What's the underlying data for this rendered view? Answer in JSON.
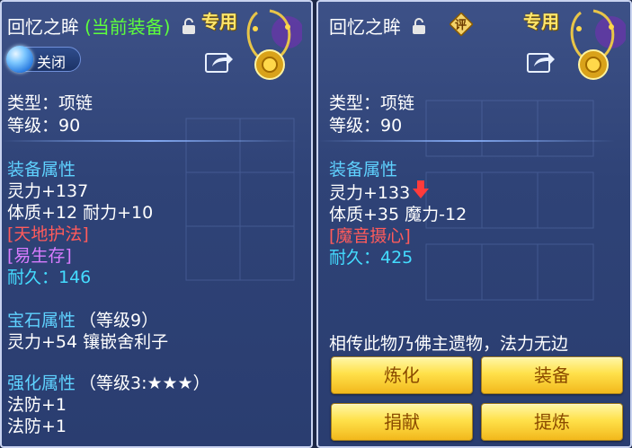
{
  "left": {
    "title": "回忆之眸",
    "equipped_tag": "(当前装备)",
    "exclusive": "专用",
    "toggle_label": "关闭",
    "type_line": "类型：项链",
    "level_line": "等级：90",
    "equip_attr_header": "装备属性",
    "attr_line1": "灵力+137",
    "attr_line2": "体质+12 耐力+10",
    "skill1": "[天地护法]",
    "skill2": "[易生存]",
    "durability": "耐久：146",
    "gem_header": "宝石属性",
    "gem_level": "（等级9）",
    "gem_line": "灵力+54 镶嵌舍利子",
    "enhance_header": "强化属性",
    "enhance_level": "（等级3:★★★）",
    "enhance_line1": "法防+1",
    "enhance_line2": "法防+1"
  },
  "right": {
    "title": "回忆之眸",
    "eval_badge": "评",
    "exclusive": "专用",
    "type_line": "类型：项链",
    "level_line": "等级：90",
    "equip_attr_header": "装备属性",
    "attr_line1": "灵力+133",
    "attr_line2": "体质+35 魔力-12",
    "skill1": "[魔音摄心]",
    "durability": "耐久：425",
    "description": "相传此物乃佛主遗物，法力无边",
    "buttons": {
      "refine": "炼化",
      "equip": "装备",
      "donate": "捐献",
      "extract": "提炼"
    }
  },
  "colors": {
    "panel_bg": "#2f4377",
    "category": "#5fd2ff",
    "skill_red": "#ff5b5b",
    "skill_purple": "#d97cff",
    "durability": "#44dcff",
    "equipped_green": "#5dff3c",
    "button_gold": "#ffe14a"
  },
  "icons": [
    "lock-icon",
    "share-icon",
    "necklace-icon",
    "toggle-icon",
    "down-arrow-icon",
    "evaluate-icon"
  ]
}
